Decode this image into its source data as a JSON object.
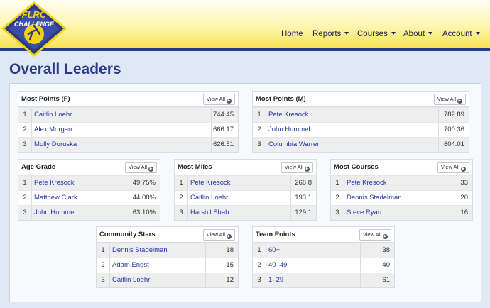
{
  "logo": {
    "top_text": "FLRC",
    "bottom_text": "CHALLENGE"
  },
  "nav": {
    "home": "Home",
    "reports": "Reports",
    "courses": "Courses",
    "about": "About",
    "account": "Account"
  },
  "page": {
    "title": "Overall Leaders"
  },
  "view_all_label": "View All",
  "cards": [
    {
      "title": "Most Points (F)",
      "rows": [
        {
          "rank": "1",
          "name": "Caitlin Loehr",
          "value": "744.45"
        },
        {
          "rank": "2",
          "name": "Alex Morgan",
          "value": "666.17"
        },
        {
          "rank": "3",
          "name": "Molly Doruska",
          "value": "626.51"
        }
      ]
    },
    {
      "title": "Most Points (M)",
      "rows": [
        {
          "rank": "1",
          "name": "Pete Kresock",
          "value": "782.89"
        },
        {
          "rank": "2",
          "name": "John Hummel",
          "value": "700.36"
        },
        {
          "rank": "3",
          "name": "Columbia Warren",
          "value": "604.01"
        }
      ]
    },
    {
      "title": "Age Grade",
      "rows": [
        {
          "rank": "1",
          "name": "Pete Kresock",
          "value": "49.75%"
        },
        {
          "rank": "2",
          "name": "Matthew Clark",
          "value": "44.08%"
        },
        {
          "rank": "3",
          "name": "John Hummel",
          "value": "63.10%"
        }
      ]
    },
    {
      "title": "Most Miles",
      "rows": [
        {
          "rank": "1",
          "name": "Pete Kresock",
          "value": "266.8"
        },
        {
          "rank": "2",
          "name": "Caitlin Loehr",
          "value": "193.1"
        },
        {
          "rank": "3",
          "name": "Harshil Shah",
          "value": "129.1"
        }
      ]
    },
    {
      "title": "Most Courses",
      "rows": [
        {
          "rank": "1",
          "name": "Pete Kresock",
          "value": "33"
        },
        {
          "rank": "2",
          "name": "Dennis Stadelman",
          "value": "20"
        },
        {
          "rank": "3",
          "name": "Steve Ryan",
          "value": "16"
        }
      ]
    },
    {
      "title": "Community Stars",
      "rows": [
        {
          "rank": "1",
          "name": "Dennis Stadelman",
          "value": "18"
        },
        {
          "rank": "2",
          "name": "Adam Engst",
          "value": "15"
        },
        {
          "rank": "3",
          "name": "Caitlin Loehr",
          "value": "12"
        }
      ]
    },
    {
      "title": "Team Points",
      "rows": [
        {
          "rank": "1",
          "name": "60+",
          "value": "38"
        },
        {
          "rank": "2",
          "name": "40–49",
          "value": "40"
        },
        {
          "rank": "3",
          "name": "1–29",
          "value": "61"
        }
      ]
    }
  ]
}
